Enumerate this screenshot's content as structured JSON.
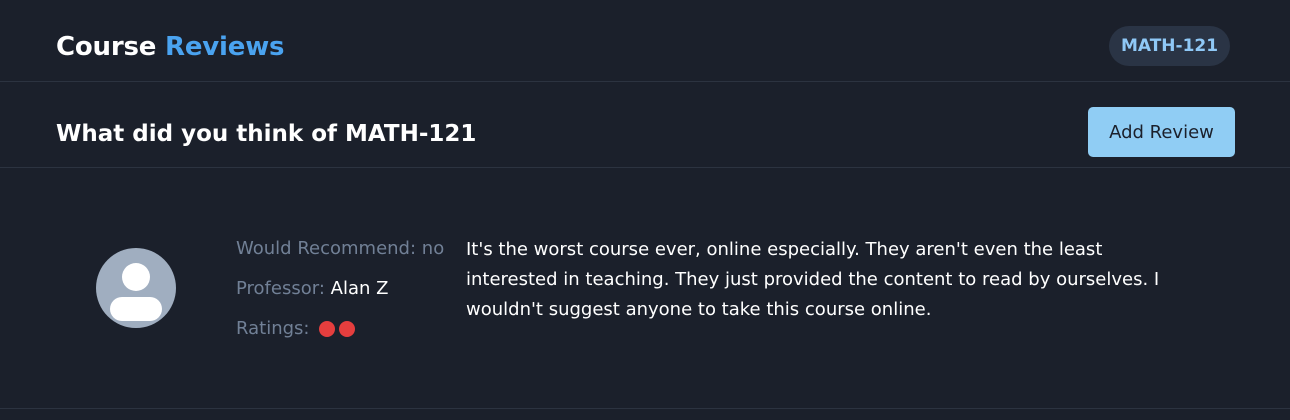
{
  "header": {
    "title_part1": "Course",
    "title_part2": "Reviews",
    "course_code": "MATH-121"
  },
  "subheader": {
    "prompt": "What did you think of MATH-121",
    "add_review_label": "Add Review"
  },
  "review": {
    "avatar_icon": "user-avatar-icon",
    "recommend_label": "Would Recommend:",
    "recommend_value": "no",
    "professor_label": "Professor:",
    "professor_value": "Alan Z",
    "ratings_label": "Ratings:",
    "rating_value": 2,
    "rating_color": "#e53e3e",
    "text": "It's the worst course ever, online especially. They aren't even the least interested in teaching. They just provided the content to read by ourselves. I wouldn't suggest anyone to take this course online."
  },
  "colors": {
    "background": "#1b202b",
    "accent": "#4aa3f0",
    "button": "#90cdf4",
    "muted_text": "#718096"
  }
}
